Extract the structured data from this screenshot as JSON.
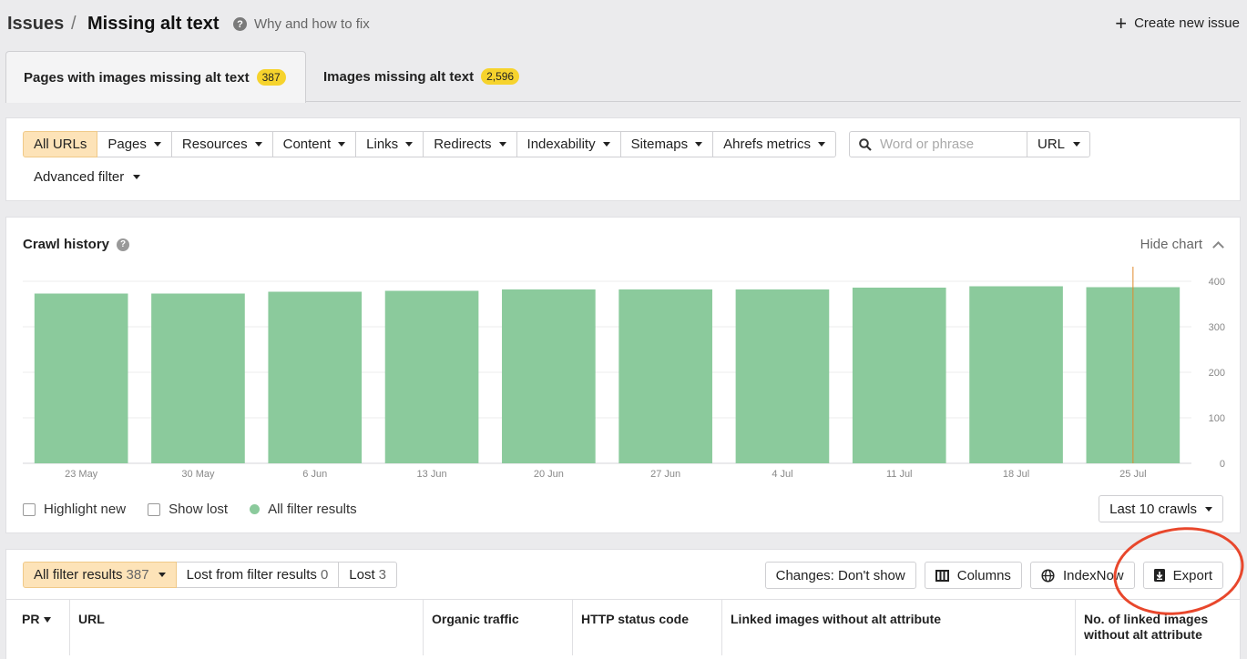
{
  "header": {
    "breadcrumb_root": "Issues",
    "separator": "/",
    "title": "Missing alt text",
    "help_link": "Why and how to fix",
    "create_issue": "Create new issue"
  },
  "tabs": [
    {
      "label": "Pages with images missing alt text",
      "count": "387",
      "active": true
    },
    {
      "label": "Images missing alt text",
      "count": "2,596",
      "active": false
    }
  ],
  "filters": {
    "buttons": [
      "All URLs",
      "Pages",
      "Resources",
      "Content",
      "Links",
      "Redirects",
      "Indexability",
      "Sitemaps",
      "Ahrefs metrics"
    ],
    "search_placeholder": "Word or phrase",
    "search_scope": "URL",
    "advanced": "Advanced filter"
  },
  "chart_panel": {
    "title": "Crawl history",
    "hide_label": "Hide chart",
    "legend": {
      "highlight_new": "Highlight new",
      "show_lost": "Show lost",
      "series": "All filter results"
    },
    "crawls_select": "Last 10 crawls"
  },
  "chart_data": {
    "type": "bar",
    "categories": [
      "23 May",
      "30 May",
      "6 Jun",
      "13 Jun",
      "20 Jun",
      "27 Jun",
      "4 Jul",
      "11 Jul",
      "18 Jul",
      "25 Jul"
    ],
    "series": [
      {
        "name": "All filter results",
        "values": [
          373,
          373,
          377,
          379,
          382,
          382,
          382,
          386,
          389,
          387
        ]
      }
    ],
    "yticks": [
      0,
      100,
      200,
      300,
      400
    ],
    "ylim": [
      0,
      400
    ],
    "color": "#8bca9c",
    "axis_side": "right",
    "grid": true
  },
  "results": {
    "tabs": [
      {
        "label": "All filter results",
        "count": "387"
      },
      {
        "label": "Lost from filter results",
        "count": "0"
      },
      {
        "label": "Lost",
        "count": "3"
      }
    ],
    "actions": {
      "changes": "Changes: Don't show",
      "columns": "Columns",
      "indexnow": "IndexNow",
      "export": "Export"
    },
    "columns": [
      "PR",
      "URL",
      "Organic traffic",
      "HTTP status code",
      "Linked images without alt attribute",
      "No. of linked images without alt attribute"
    ]
  }
}
